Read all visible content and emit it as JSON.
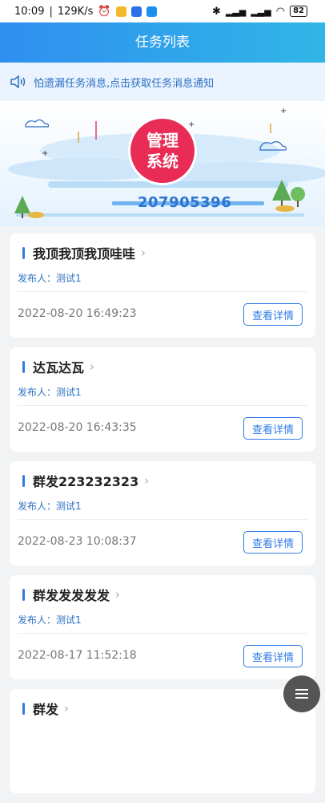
{
  "status_bar": {
    "time": "10:09",
    "speed": "129K/s",
    "battery": "82"
  },
  "header": {
    "title": "任务列表"
  },
  "notice": {
    "text": "怕遗漏任务消息,点击获取任务消息通知"
  },
  "banner": {
    "logo_line1": "管理",
    "logo_line2": "系统",
    "number": "207905396"
  },
  "tasks": [
    {
      "title": "我顶我顶我顶哇哇",
      "publisher_label": "发布人：",
      "publisher": "测试1",
      "date": "2022-08-20 16:49:23",
      "button": "查看详情"
    },
    {
      "title": "达瓦达瓦",
      "publisher_label": "发布人：",
      "publisher": "测试1",
      "date": "2022-08-20 16:43:35",
      "button": "查看详情"
    },
    {
      "title": "群发223232323",
      "publisher_label": "发布人：",
      "publisher": "测试1",
      "date": "2022-08-23 10:08:37",
      "button": "查看详情"
    },
    {
      "title": "群发发发发发",
      "publisher_label": "发布人：",
      "publisher": "测试1",
      "date": "2022-08-17 11:52:18",
      "button": "查看详情"
    },
    {
      "title": "群发",
      "publisher_label": "",
      "publisher": "",
      "date": "",
      "button": ""
    }
  ],
  "colors": {
    "accent": "#2f7be6",
    "logo_red": "#e82c55"
  }
}
